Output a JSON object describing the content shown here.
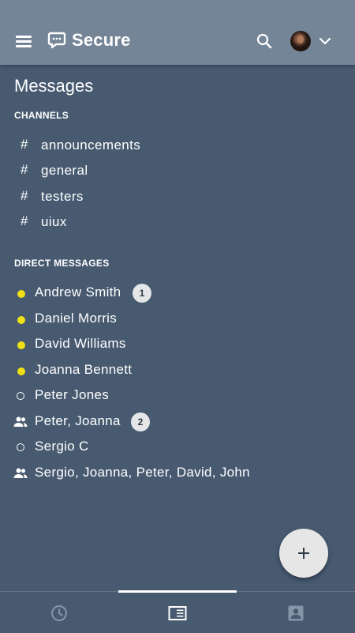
{
  "app": {
    "title": "Secure"
  },
  "header": {
    "menu_icon": "hamburger-menu-icon",
    "logo_icon": "chat-bubble-logo-icon",
    "search_icon": "search-icon",
    "avatar": "user-avatar",
    "account_icon": "chevron-down-icon"
  },
  "page": {
    "title": "Messages"
  },
  "channels": {
    "header": "CHANNELS",
    "items": [
      {
        "label": "announcements"
      },
      {
        "label": "general"
      },
      {
        "label": "testers"
      },
      {
        "label": "uiux"
      }
    ]
  },
  "direct_messages": {
    "header": "DIRECT MESSAGES",
    "items": [
      {
        "label": "Andrew Smith",
        "status": "online",
        "badge": "1"
      },
      {
        "label": "Daniel Morris",
        "status": "online"
      },
      {
        "label": "David Williams",
        "status": "online"
      },
      {
        "label": "Joanna Bennett",
        "status": "online"
      },
      {
        "label": "Peter Jones",
        "status": "offline"
      },
      {
        "label": "Peter, Joanna",
        "status": "group",
        "badge": "2"
      },
      {
        "label": "Sergio C",
        "status": "offline"
      },
      {
        "label": "Sergio, Joanna, Peter, David, John",
        "status": "group"
      }
    ]
  },
  "fab": {
    "icon": "plus-icon"
  },
  "bottom_nav": {
    "tabs": [
      {
        "icon": "clock-icon"
      },
      {
        "icon": "list-view-icon",
        "active": true
      },
      {
        "icon": "contact-icon"
      }
    ]
  },
  "colors": {
    "appbar": "#748597",
    "background": "#475a70",
    "online_status": "#f0e016",
    "badge": "#e4e6e8",
    "fab": "#e6e6e6"
  }
}
